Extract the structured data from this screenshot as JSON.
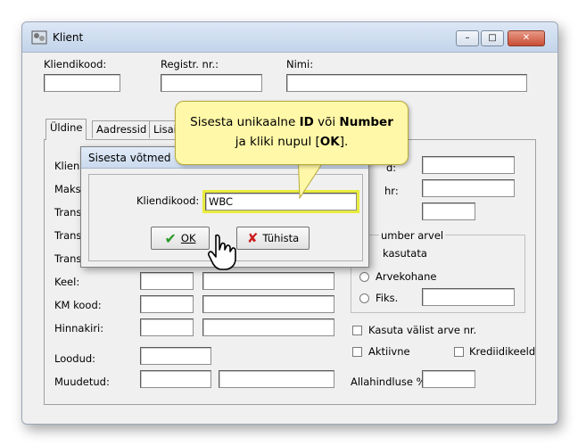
{
  "window": {
    "title": "Klient",
    "minimize": "–",
    "maximize": "□",
    "close": "✕"
  },
  "header": {
    "kliendikood_label": "Kliendikood:",
    "registr_label": "Registr. nr.:",
    "nimi_label": "Nimi:"
  },
  "tabs": [
    "Üldine",
    "Aadressid",
    "Lisai"
  ],
  "left_labels": [
    "Klien",
    "Maks",
    "Trans",
    "Trans",
    "Trans"
  ],
  "form": {
    "keel": "Keel:",
    "km_kood": "KM kood:",
    "hinnakiri": "Hinnakiri:",
    "loodud": "Loodud:",
    "muudetud": "Muudetud:",
    "right_label1": "d:",
    "right_label2": "hr:",
    "group_title": "umber arvel",
    "radio_kasutata": "kasutata",
    "radio_arvekohane": "Arvekohane",
    "radio_fiks": "Fiks.",
    "kasuta_valist": "Kasuta välist arve nr.",
    "aktiivne": "Aktiivne",
    "krediidikeeld": "Krediidikeeld",
    "allahindluse": "Allahindluse %:"
  },
  "dialog": {
    "title": "Sisesta võtmed",
    "field_label": "Kliendikood:",
    "field_value": "WBC",
    "ok_label": "OK",
    "cancel_label": "Tühista"
  },
  "callout": {
    "line1_pre": "Sisesta unikaalne ",
    "line1_b1": "ID",
    "line1_mid": " või ",
    "line1_b2": "Number",
    "line2_pre": "ja kliki nupul [",
    "line2_b": "OK",
    "line2_post": "]."
  },
  "colors": {
    "callout_bg": "#fff8a8",
    "highlight": "#e8ec3c",
    "ok_check": "#2a9a2a",
    "cancel_x": "#cc1f1f"
  }
}
